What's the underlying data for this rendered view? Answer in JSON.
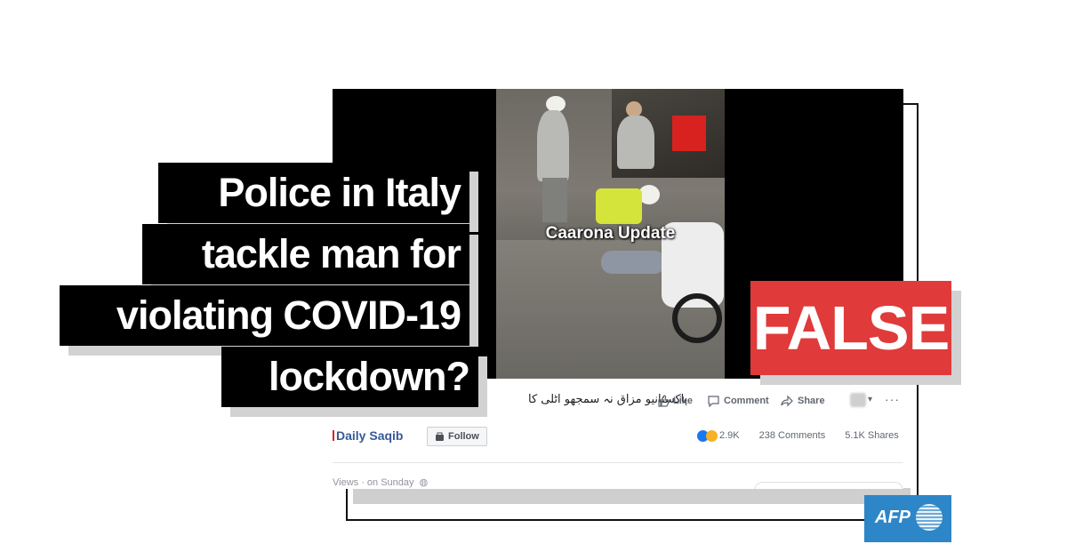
{
  "headline": {
    "lines": [
      "Police in Italy",
      "tackle man for",
      "violating COVID-19",
      "lockdown?"
    ]
  },
  "verdict": {
    "label": "FALSE",
    "color": "#e03a3a"
  },
  "video": {
    "caption": "Caarona Update"
  },
  "post": {
    "urdu_text": "پاکستانیو مزاق نہ سمجھو اٹلی کا",
    "actions": {
      "like": "Like",
      "comment": "Comment",
      "share": "Share"
    },
    "page_name": "Daily Saqib",
    "follow_label": "Follow",
    "reactions_count": "2.9K",
    "comments_count": "238 Comments",
    "shares_count": "5.1K Shares",
    "views_text": "Views · on Sunday"
  },
  "agency": {
    "logo_text": "AFP",
    "color": "#2d86c7"
  }
}
